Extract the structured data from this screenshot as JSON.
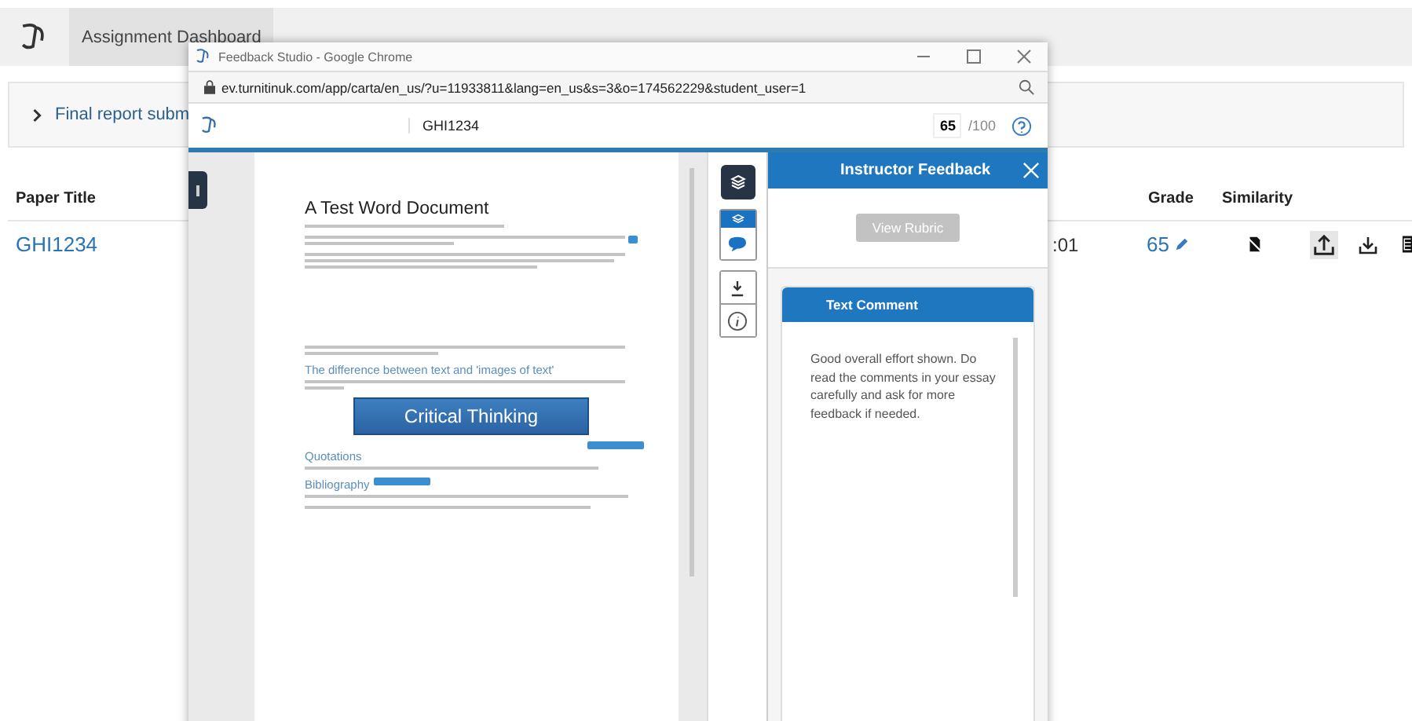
{
  "dashboard": {
    "tab": "Assignment Dashboard",
    "assignment": "Final report subm",
    "columns": [
      "Paper Title",
      "Grade",
      "Similarity"
    ],
    "row": {
      "title": "GHI1234",
      "column_2": ":01",
      "grade": "65"
    }
  },
  "popup": {
    "window_title": "Feedback Studio - Google Chrome",
    "url": "ev.turnitinuk.com/app/carta/en_us/?u=11933811&lang=en_us&s=3&o=174562229&student_user=1",
    "paper": "GHI1234",
    "grade": "65",
    "grade_max": "/100",
    "document": {
      "title": "A Test Word Document",
      "heading_1": "The difference between text and 'images of text'",
      "image_text": "Critical Thinking",
      "heading_2": "Quotations",
      "heading_3": "Bibliography"
    },
    "tools": [
      {
        "kind": "layers",
        "selected": false
      },
      {
        "kind": "comment",
        "selected": true
      }
    ],
    "panel": {
      "title": "Instructor Feedback",
      "rubric_button": "View Rubric",
      "comment_title": "Text Comment",
      "comment": "Good overall effort shown. Do read the comments in your essay carefully and ask for more feedback if needed."
    }
  }
}
